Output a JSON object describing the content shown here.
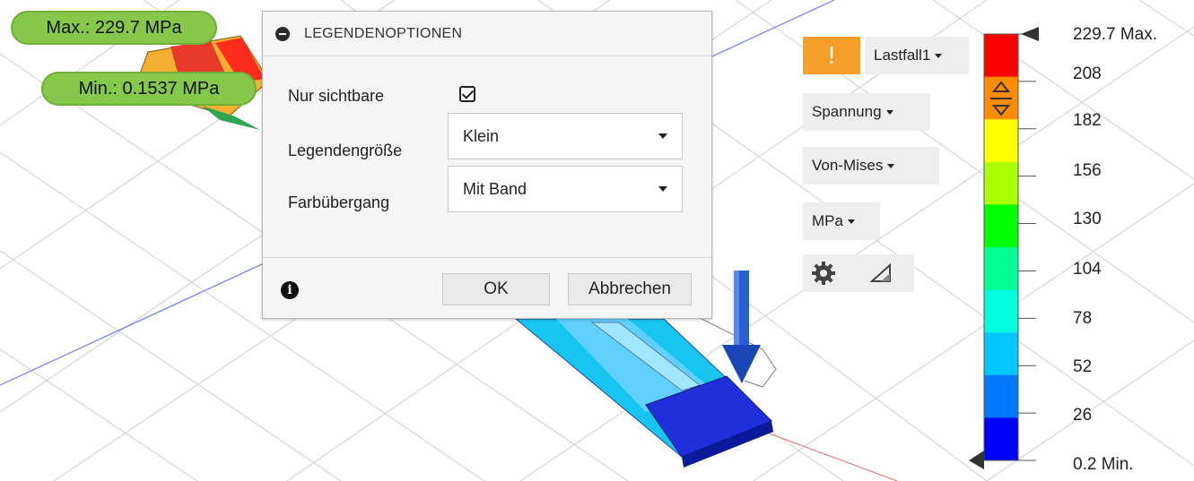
{
  "viewport": {
    "max_tag": "Max.: 229.7 MPa",
    "min_tag": "Min.: 0.1537 MPa"
  },
  "dialog": {
    "title": "LEGENDENOPTIONEN",
    "visible_only_label": "Nur sichtbare",
    "visible_only_checked": true,
    "legend_size_label": "Legendengröße",
    "legend_size_value": "Klein",
    "transition_label": "Farbübergang",
    "transition_value": "Mit Band",
    "ok_label": "OK",
    "cancel_label": "Abbrechen"
  },
  "panel": {
    "warning_glyph": "!",
    "load_case": "Lastfall1",
    "result_type": "Spannung",
    "stress_type": "Von-Mises",
    "unit": "MPa"
  },
  "legend": {
    "labels": [
      "229.7 Max.",
      "208",
      "182",
      "156",
      "130",
      "104",
      "78",
      "52",
      "26",
      "0.2 Min."
    ],
    "band_colors": [
      "#ff0000",
      "#ff8c00",
      "#ffff00",
      "#aaff00",
      "#00ff00",
      "#00ff90",
      "#00ffe0",
      "#00c8ff",
      "#0078ff",
      "#0000ff"
    ]
  },
  "colors": {
    "accent_warning": "#f5a02a",
    "tag_green": "#86c84a",
    "load_arrow": "#1a47b8"
  }
}
